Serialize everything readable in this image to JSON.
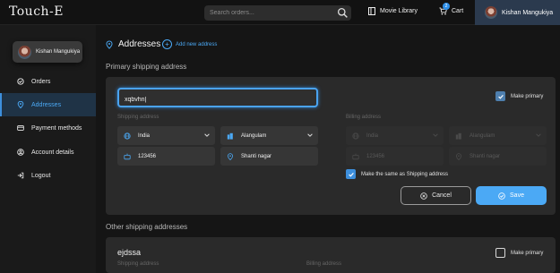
{
  "header": {
    "logo": "Touch-E",
    "search_placeholder": "Search orders...",
    "movie_library": "Movie Library",
    "cart_label": "Cart",
    "cart_count": "2",
    "user_name": "Kishan Mangukiya"
  },
  "sidebar": {
    "profile_name": "Kishan Mangukiya",
    "items": [
      {
        "label": "Orders",
        "icon": "orders-icon",
        "active": false
      },
      {
        "label": "Addresses",
        "icon": "location-pin-icon",
        "active": true
      },
      {
        "label": "Payment methods",
        "icon": "credit-card-icon",
        "active": false
      },
      {
        "label": "Account details",
        "icon": "user-icon",
        "active": false
      },
      {
        "label": "Logout",
        "icon": "logout-icon",
        "active": false
      }
    ]
  },
  "main": {
    "title": "Addresses",
    "add_new_label": "Add new address",
    "primary_section_title": "Primary shipping address",
    "other_section_title": "Other shipping addresses"
  },
  "primary_form": {
    "name_value": "xqbvhn|",
    "make_primary_label": "Make primary",
    "make_primary_checked": true,
    "shipping_label": "Shipping address",
    "billing_label": "Billing address",
    "shipping": {
      "country": "India",
      "city": "Alangulam",
      "pincode": "123456",
      "area": "Shanti nagar"
    },
    "billing": {
      "country": "India",
      "city": "Alangulam",
      "pincode": "123456",
      "area": "Shanti nagar"
    },
    "same_as_shipping_label": "Make the same as Shipping address",
    "same_as_shipping_checked": true,
    "cancel_label": "Cancel",
    "save_label": "Save"
  },
  "other_addresses": [
    {
      "name": "ejdssa",
      "make_primary_label": "Make primary",
      "make_primary_checked": false,
      "shipping_label": "Shipping address",
      "billing_label": "Billing address"
    }
  ],
  "colors": {
    "accent": "#4ba9f5",
    "active_bg": "#1f3346",
    "card_bg": "#2a2a2a",
    "page_bg": "#151515"
  }
}
